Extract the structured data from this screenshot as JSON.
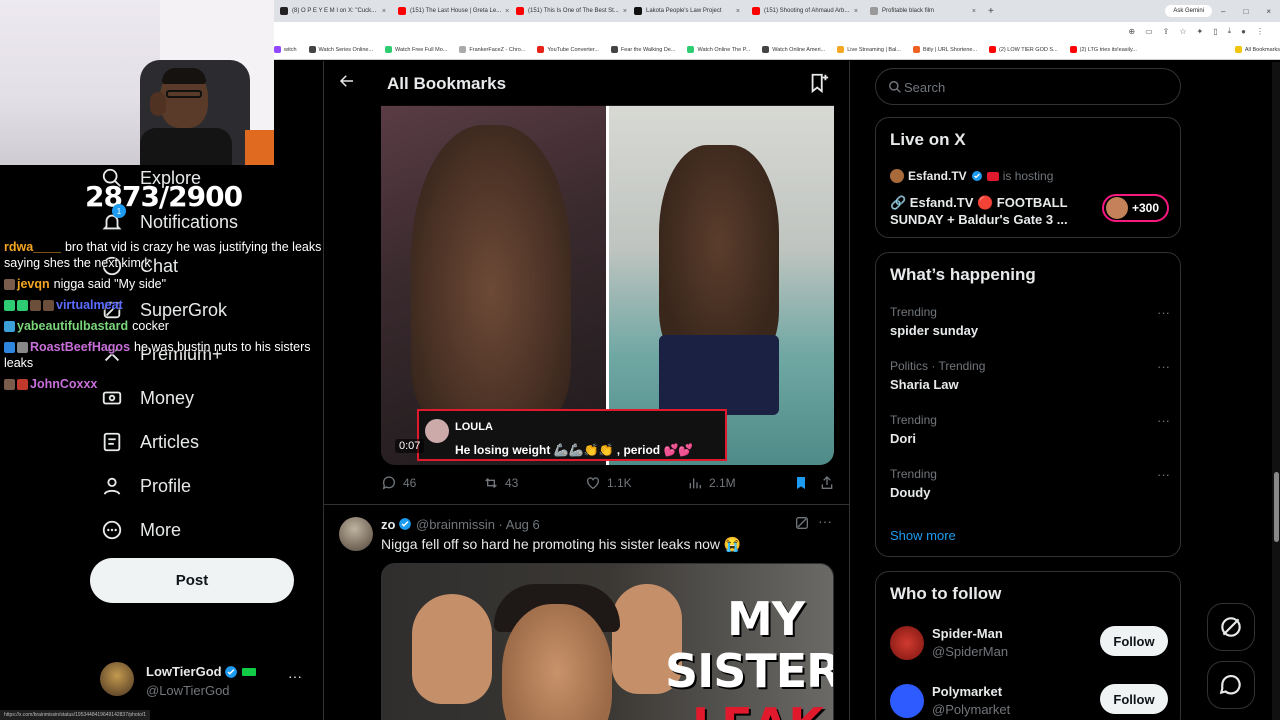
{
  "browser": {
    "tabs": [
      {
        "label": "(8) O P E Y E M I on X: \"Cuck...",
        "fav": "#222"
      },
      {
        "label": "(151) The Last House | Greta Le...",
        "fav": "#ff0000"
      },
      {
        "label": "(151) This Is One of The Best St...",
        "fav": "#ff0000"
      },
      {
        "label": "Lakota People's Law Project",
        "fav": "#111"
      },
      {
        "label": "(151) Shooting of Ahmaud Arb...",
        "fav": "#ff0000"
      },
      {
        "label": "Profitable black film",
        "fav": "#999"
      }
    ],
    "new_tab": "+",
    "ask_gemini": "Ask Gemini",
    "bookmarks": [
      {
        "label": "witch",
        "color": "#9146ff"
      },
      {
        "label": "Watch Series Online...",
        "color": "#444"
      },
      {
        "label": "Watch Free Full Mo...",
        "color": "#2ecc71"
      },
      {
        "label": "FrankerFaceZ - Chro...",
        "color": "#aaa"
      },
      {
        "label": "YouTube Converter...",
        "color": "#e62117"
      },
      {
        "label": "Fear the Walking De...",
        "color": "#444"
      },
      {
        "label": "Watch Online The P...",
        "color": "#2ecc71"
      },
      {
        "label": "Watch Online Ameri...",
        "color": "#444"
      },
      {
        "label": "Live Streaming | Bal...",
        "color": "#f5a623"
      },
      {
        "label": "Bitly | URL Shortene...",
        "color": "#ee6123"
      },
      {
        "label": "(2) LOW TIER GOD S...",
        "color": "#ff0000"
      },
      {
        "label": "(2) LTG tries its!easily...",
        "color": "#ff0000"
      },
      {
        "label": "All Bookmarks",
        "color": "#f1c40f"
      }
    ]
  },
  "overlay": {
    "counter": "2873/2900",
    "chat": [
      {
        "user": "rdwa____",
        "text": "bro that vid is crazy he was justifying the leaks saying shes the next kim k",
        "color": "#f5a623",
        "badges": []
      },
      {
        "user": "jevqn",
        "text": "nigga said \"My side\"",
        "color": "#f5a623",
        "badges": [
          "#7a5c4d"
        ]
      },
      {
        "user": "virtualmeat",
        "text": "",
        "color": "#5b6cff",
        "badges": [
          "#2ecc71",
          "#2ecc71",
          "#6b4f3a",
          "#6b4f3a"
        ]
      },
      {
        "user": "yabeautifulbastard",
        "text": "cocker",
        "color": "#7bd67b",
        "badges": [
          "#3ba1d8"
        ]
      },
      {
        "user": "RoastBeefHagos",
        "text": "he was bustin nuts to his sisters leaks",
        "color": "#c86fd9",
        "badges": [
          "#2e86de",
          "#888"
        ]
      },
      {
        "user": "JohnCoxxx",
        "text": "",
        "color": "#c86fd9",
        "badges": [
          "#7a5c4d",
          "#c0392b"
        ]
      }
    ]
  },
  "nav": {
    "items": [
      {
        "label": "Explore",
        "icon": "search-icon"
      },
      {
        "label": "Notifications",
        "icon": "bell-icon",
        "badge": "1"
      },
      {
        "label": "Chat",
        "icon": "chat-icon"
      },
      {
        "label": "SuperGrok",
        "icon": "grok-icon"
      },
      {
        "label": "Premium+",
        "icon": "x-premium-icon"
      },
      {
        "label": "Money",
        "icon": "money-icon"
      },
      {
        "label": "Articles",
        "icon": "articles-icon"
      },
      {
        "label": "Profile",
        "icon": "person-icon"
      },
      {
        "label": "More",
        "icon": "more-circle-icon"
      }
    ],
    "post_label": "Post",
    "account": {
      "name": "LowTierGod",
      "handle": "@LowTierGod",
      "more": "···"
    }
  },
  "center": {
    "title": "All Bookmarks",
    "tweet1": {
      "caption_user": "LOULA",
      "caption_text": "He losing weight 🦾🦾👏👏 , period 💕💕",
      "duration": "0:07",
      "replies": "46",
      "reposts": "43",
      "likes": "1.1K",
      "views": "2.1M"
    },
    "tweet2": {
      "name": "zo",
      "handle": "@brainmissin · Aug 6",
      "text": "Nigga fell off so hard he promoting his sister leaks now 😭",
      "thumb_line1": "MY",
      "thumb_line2": "SISTER",
      "thumb_line3": "LEAK",
      "more": "···"
    }
  },
  "right": {
    "search_placeholder": "Search",
    "live": {
      "title": "Live on X",
      "host_name": "Esfand.TV",
      "host_suffix": "is hosting",
      "stream_title": "🔗 Esfand.TV 🔴 FOOTBALL SUNDAY + Baldur's Gate 3 ...",
      "count": "+300"
    },
    "happening": {
      "title": "What’s happening",
      "trends": [
        {
          "meta": "Trending",
          "name": "spider sunday"
        },
        {
          "meta": "Politics · Trending",
          "name": "Sharia Law"
        },
        {
          "meta": "Trending",
          "name": "Dori"
        },
        {
          "meta": "Trending",
          "name": "Doudy"
        }
      ],
      "show_more": "Show more"
    },
    "who_to_follow": {
      "title": "Who to follow",
      "accounts": [
        {
          "name": "Spider-Man",
          "handle": "@SpiderMan",
          "button": "Follow",
          "color": "#c0392b"
        },
        {
          "name": "Polymarket",
          "handle": "@Polymarket",
          "button": "Follow",
          "color": "#2e5bff"
        }
      ]
    }
  },
  "status_url": "https://x.com/brainmissin/status/1953448419649142837/photo/1"
}
